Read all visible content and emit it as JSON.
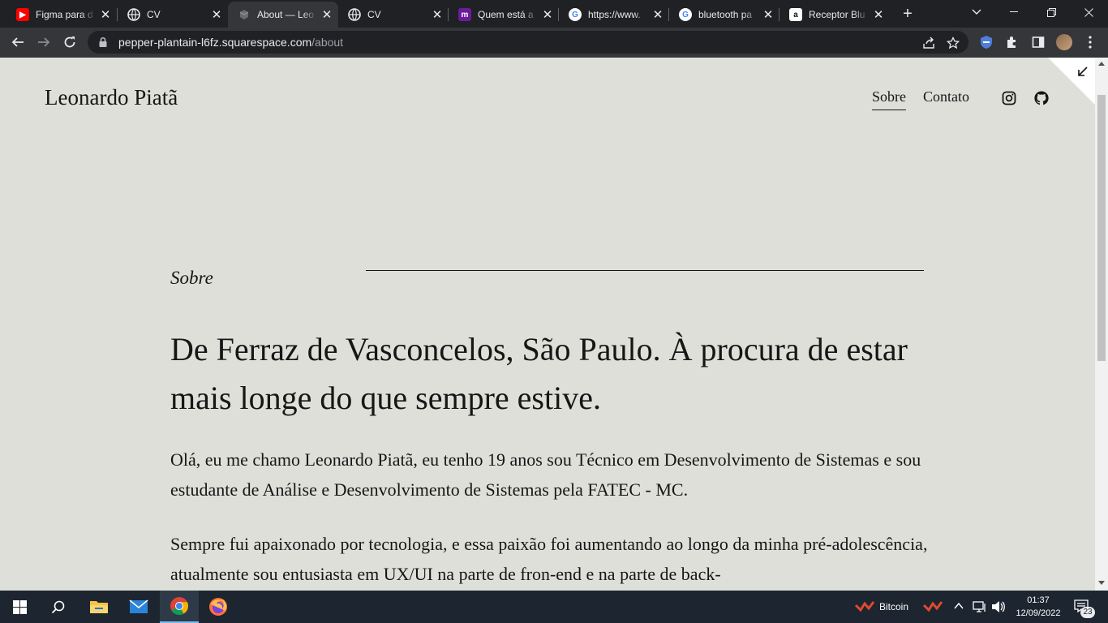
{
  "browser": {
    "tabs": [
      {
        "title": "Figma para d",
        "icon": "youtube-icon",
        "color": "#ff0000"
      },
      {
        "title": "CV",
        "icon": "globe-icon",
        "color": "#e8eaed"
      },
      {
        "title": "About — Leo",
        "icon": "squarespace-icon",
        "color": "#9aa0a6",
        "active": true
      },
      {
        "title": "CV",
        "icon": "globe-icon",
        "color": "#e8eaed"
      },
      {
        "title": "Quem está a",
        "icon": "medium-m-icon",
        "color": "#6a1b9a"
      },
      {
        "title": "https://www.",
        "icon": "google-icon",
        "color": "#4285f4"
      },
      {
        "title": "bluetooth pa",
        "icon": "google-icon",
        "color": "#4285f4"
      },
      {
        "title": "Receptor Blu",
        "icon": "amazon-icon",
        "color": "#e8eaed"
      }
    ],
    "url_host": "pepper-plantain-l6fz.squarespace.com",
    "url_path": "/about"
  },
  "site": {
    "brand": "Leonardo Piatã",
    "nav": [
      {
        "label": "Sobre",
        "active": true
      },
      {
        "label": "Contato",
        "active": false
      }
    ],
    "social": [
      "instagram-icon",
      "github-icon"
    ]
  },
  "content": {
    "section_label": "Sobre",
    "headline": "De Ferraz de Vasconcelos, São Paulo. À procura de estar mais longe do que sempre estive.",
    "paragraph1": "Olá, eu me chamo Leonardo Piatã, eu tenho 19 anos sou Técnico em Desenvolvimento de Sistemas e sou estudante de Análise e Desenvolvimento de Sistemas pela FATEC - MC.",
    "paragraph2": "Sempre fui apaixonado por tecnologia, e essa paixão foi aumentando ao longo da minha pré-adolescência, atualmente sou entusiasta em UX/UI na parte de fron-end e na parte de back-"
  },
  "taskbar": {
    "tray_label": "Bitcoin",
    "time": "01:37",
    "date": "12/09/2022",
    "notifications": "23"
  },
  "colors": {
    "page_bg": "#dfdfda",
    "text": "#161616",
    "chrome_dark": "#202124",
    "chrome_toolbar": "#35363a",
    "taskbar": "#1c2530"
  }
}
